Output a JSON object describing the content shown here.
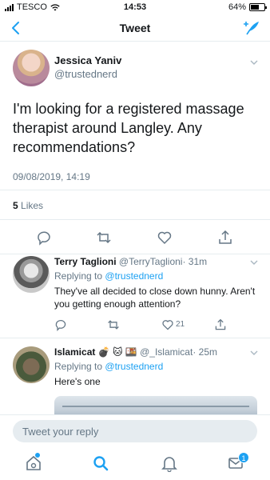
{
  "status": {
    "carrier": "TESCO",
    "time": "14:53",
    "battery": "64%",
    "battery_level": 0.64
  },
  "nav": {
    "title": "Tweet"
  },
  "tweet": {
    "name": "Jessica Yaniv",
    "handle": "@trustednerd",
    "text": "I'm looking for a registered massage therapist around Langley. Any recommendations?",
    "timestamp": "09/08/2019, 14:19",
    "likes_count": "5",
    "likes_label": "Likes"
  },
  "replies": [
    {
      "name": "Terry Taglioni",
      "handle": "@TerryTaglioni",
      "time": "· 31m",
      "replying_prefix": "Replying to",
      "replying_to": "@trustednerd",
      "text": "They've all decided to close down hunny. Aren't you getting enough attention?",
      "like_count": "21"
    },
    {
      "name": "Islamicat 💣 🐱 🍱",
      "handle": "@_Islamicat",
      "time": "· 25m",
      "replying_prefix": "Replying to",
      "replying_to": "@trustednerd",
      "text": "Here's one"
    }
  ],
  "composer": {
    "placeholder": "Tweet your reply"
  },
  "tabbar": {
    "notifications_badge": "1"
  },
  "colors": {
    "accent": "#1da1f2",
    "secondary_text": "#657786",
    "divider": "#e6ecf0"
  }
}
